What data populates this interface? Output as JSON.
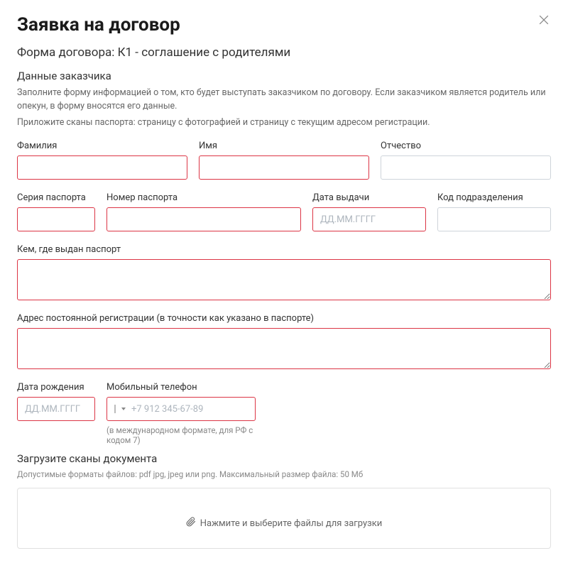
{
  "header": {
    "title": "Заявка на договор",
    "subtitle": "Форма договора: К1 - соглашение с родителями"
  },
  "customer": {
    "section_title": "Данные заказчика",
    "desc1": "Заполните форму информацией о том, кто будет выступать заказчиком по договору. Если заказчиком является родитель или опекун, в форму вносятся его данные.",
    "desc2": "Приложите сканы паспорта: страницу с фотографией и страницу с текущим адресом регистрации.",
    "lastname_label": "Фамилия",
    "firstname_label": "Имя",
    "patronymic_label": "Отчество",
    "passport_series_label": "Серия паспорта",
    "passport_number_label": "Номер паспорта",
    "issue_date_label": "Дата выдачи",
    "issue_date_placeholder": "ДД.ММ.ГГГГ",
    "dept_code_label": "Код подразделения",
    "issued_by_label": "Кем, где выдан паспорт",
    "reg_address_label": "Адрес постоянной регистрации (в точности как указано в паспорте)",
    "birthdate_label": "Дата рождения",
    "birthdate_placeholder": "ДД.ММ.ГГГГ",
    "phone_label": "Мобильный телефон",
    "phone_placeholder": "+7 912 345-67-89",
    "phone_hint": "(в международном формате, для РФ с кодом 7)"
  },
  "upload": {
    "section_title": "Загрузите сканы документа",
    "hint": "Допустимые форматы файлов: pdf jpg, jpeg или png. Максимальный размер файла: 50 Мб",
    "dropzone_text": "Нажмите и выберите файлы для загрузки"
  }
}
